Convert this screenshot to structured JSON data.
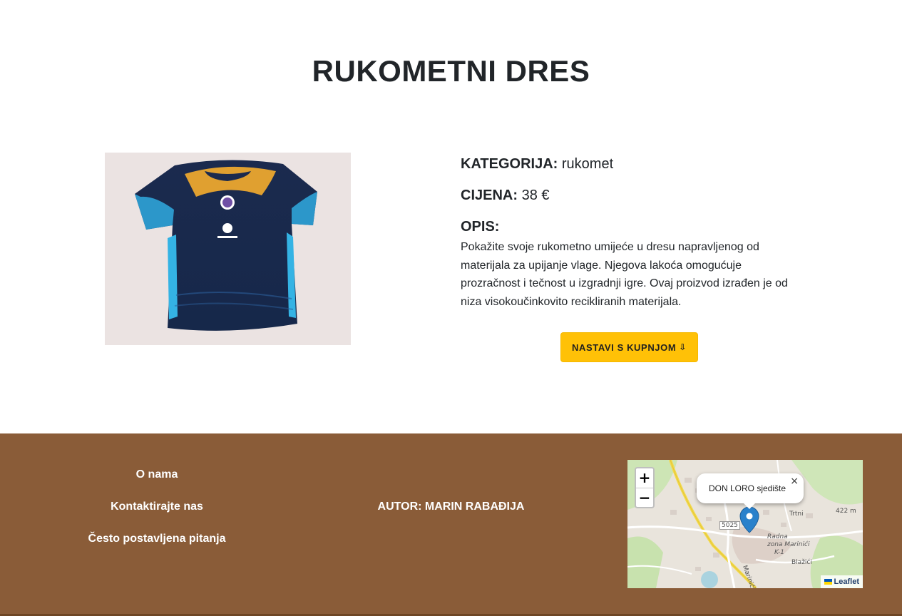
{
  "product": {
    "title": "RUKOMETNI DRES",
    "category_label": "KATEGORIJA:",
    "category_value": "rukomet",
    "price_label": "CIJENA:",
    "price_value": "38 €",
    "description_label": "OPIS:",
    "description": "Pokažite svoje rukometno umijeće u dresu napravljenog od materijala za upijanje vlage. Njegova lakoća omogućuje prozračnost i tečnost u izgradnji igre. Ovaj proizvod izrađen je od niza visokoučinkovito recikliranih materijala.",
    "image_icon": "jersey-image",
    "continue_button": "NASTAVI S KUPNJOM",
    "continue_icon": "down-arrow-icon"
  },
  "footer": {
    "links": [
      "O nama",
      "Kontaktirajte nas",
      "Često postavljena pitanja"
    ],
    "author": "AUTOR: MARIN RABAĐIJA"
  },
  "map": {
    "zoom_in": "+",
    "zoom_out": "−",
    "popup_text": "DON LORO sjedište",
    "popup_close": "×",
    "attribution": "Leaflet",
    "labels": {
      "road": "5025",
      "trtni": "Trtni",
      "elevation": "422 m",
      "zone1": "Radna",
      "zone2": "zona Marinići",
      "zone3": "K-1",
      "blazici": "Blažići",
      "marinici": "Marinići"
    }
  },
  "colors": {
    "footer_bg": "#8a5c38",
    "button_bg": "#ffc107",
    "marker": "#2a81cb"
  }
}
